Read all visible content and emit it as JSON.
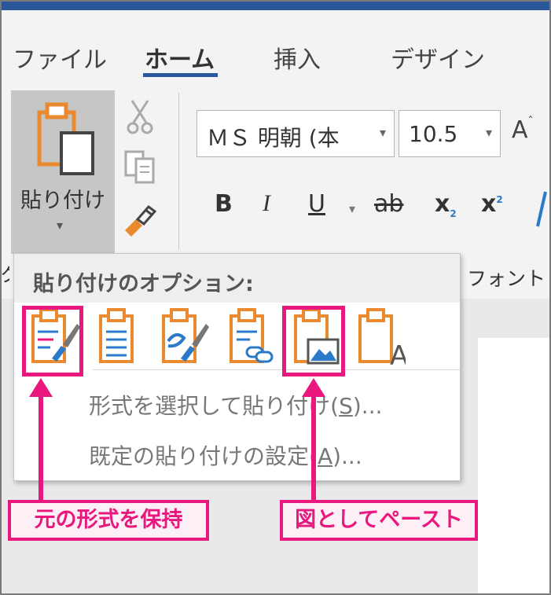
{
  "tabs": [
    {
      "label": "ファイル"
    },
    {
      "label": "ホーム"
    },
    {
      "label": "挿入"
    },
    {
      "label": "デザイン"
    }
  ],
  "clipboard": {
    "paste_label": "貼り付け"
  },
  "font": {
    "name": "ＭＳ 明朝 (本",
    "size": "10.5",
    "grow_label": "A",
    "bold_label": "B",
    "italic_label": "I",
    "underline_label": "U",
    "strike_label": "ab",
    "subscript_label": "x",
    "superscript_label": "x",
    "group_label": "フォント",
    "clipboard_group_label_fragment": "ク"
  },
  "paste_menu": {
    "header": "貼り付けのオプション:",
    "items": [
      {
        "label": "形式を選択して貼り付け(",
        "accel": "S",
        "tail": ")..."
      },
      {
        "label": "既定の貼り付けの設定(",
        "accel": "A",
        "tail": ")..."
      }
    ]
  },
  "annotations": {
    "keep_source": "元の形式を保持",
    "paste_as_picture": "図としてペースト"
  },
  "colors": {
    "accent_blue": "#2b579a",
    "highlight_pink": "#e8187e",
    "clipboard_orange": "#e88a2d"
  }
}
